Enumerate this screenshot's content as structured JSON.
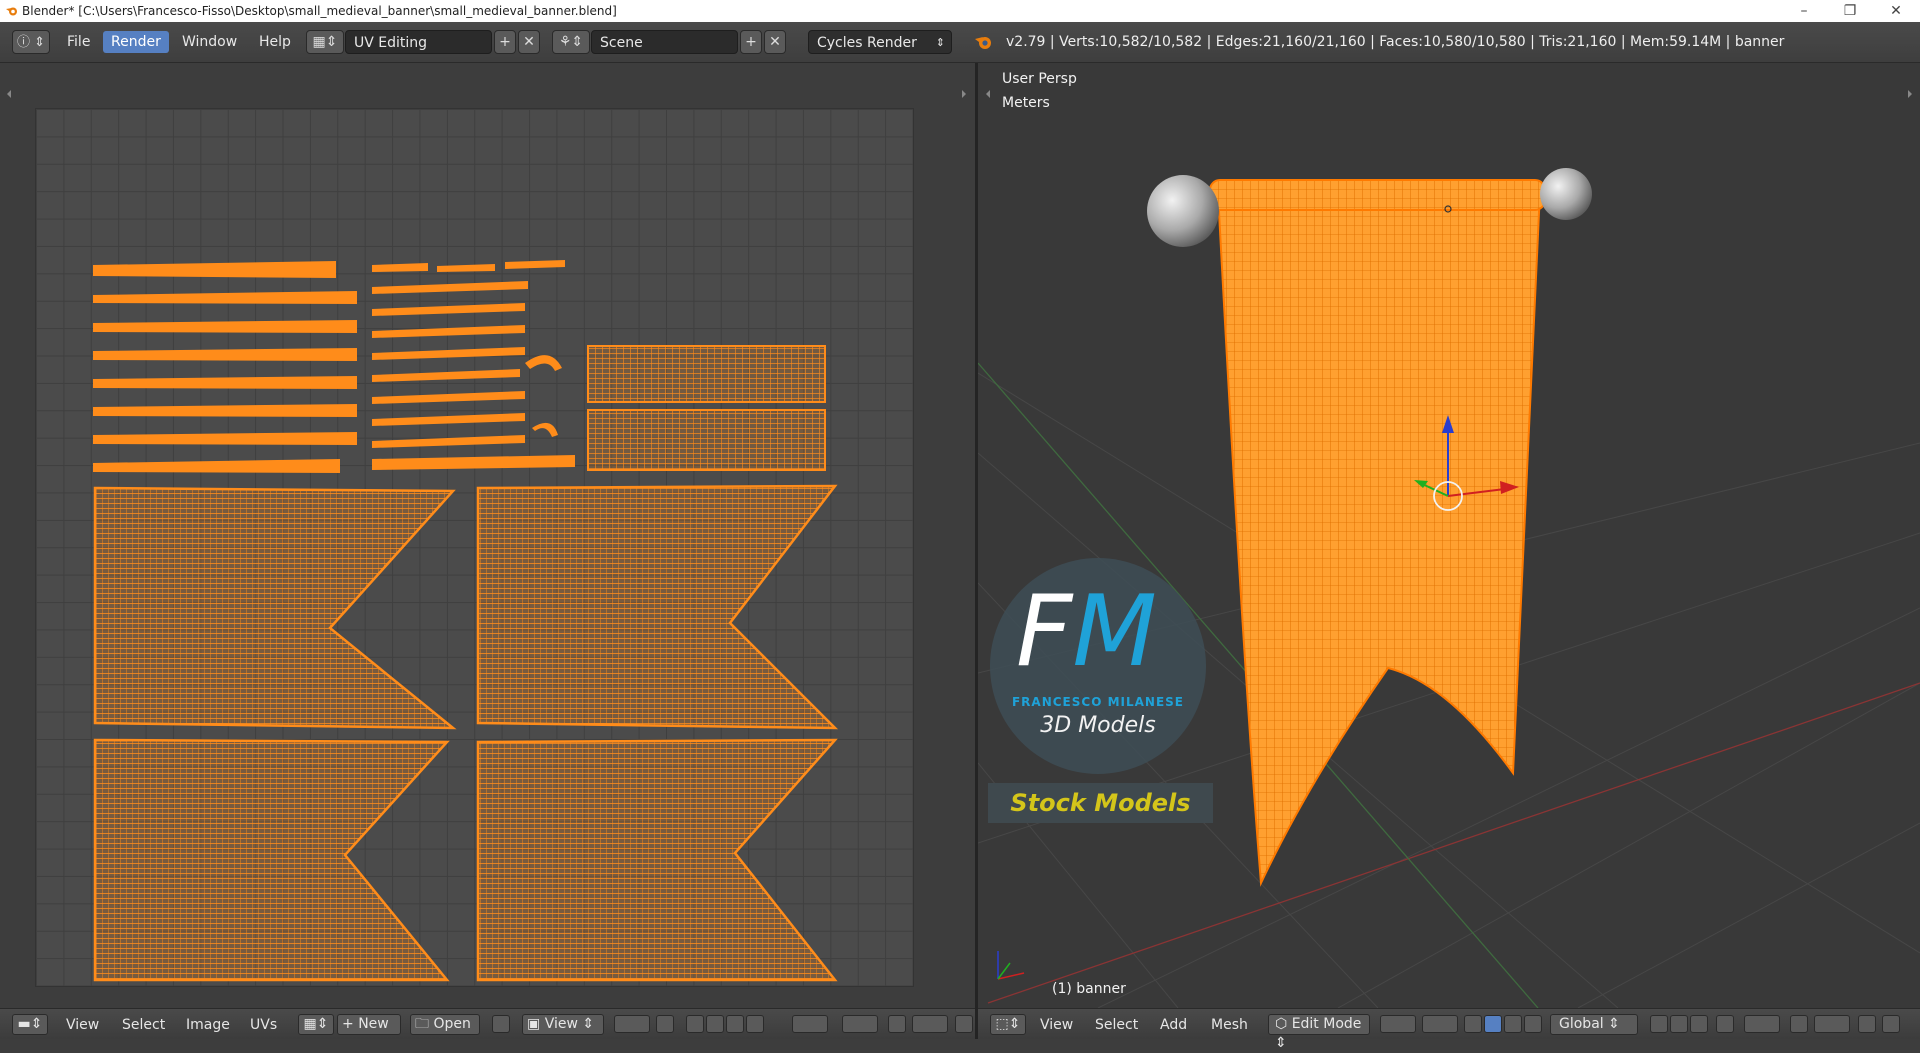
{
  "titlebar": {
    "title": "Blender* [C:\\Users\\Francesco-Fisso\\Desktop\\small_medieval_banner\\small_medieval_banner.blend]",
    "minimize": "–",
    "maximize": "❐",
    "close": "✕"
  },
  "infobar": {
    "menus": [
      "File",
      "Render",
      "Window",
      "Help"
    ],
    "active_menu": "Render",
    "screen_layout": "UV Editing",
    "scene": "Scene",
    "render_engine": "Cycles Render",
    "stats": "v2.79 | Verts:10,582/10,582 | Edges:21,160/21,160 | Faces:10,580/10,580 | Tris:21,160 | Mem:59.14M | banner"
  },
  "viewport": {
    "view_name": "User Persp",
    "units": "Meters",
    "object_label": "(1) banner"
  },
  "watermark": {
    "initials_f": "F",
    "initials_m": "M",
    "author": "FRANCESCO MILANESE",
    "tagline": "3D Models",
    "badge": "Stock Models"
  },
  "uv_footer": {
    "menus": [
      "View",
      "Select",
      "Image",
      "UVs"
    ],
    "new_label": "New",
    "open_label": "Open",
    "view_label": "View"
  },
  "vp_footer": {
    "menus": [
      "View",
      "Select",
      "Add",
      "Mesh"
    ],
    "mode": "Edit Mode",
    "orientation": "Global"
  },
  "colors": {
    "accent": "#5680c2",
    "wire": "#ff8c1a",
    "banner_fill": "#ffa030",
    "badge_text": "#d4c51a",
    "logo_blue": "#1fa2d8"
  }
}
